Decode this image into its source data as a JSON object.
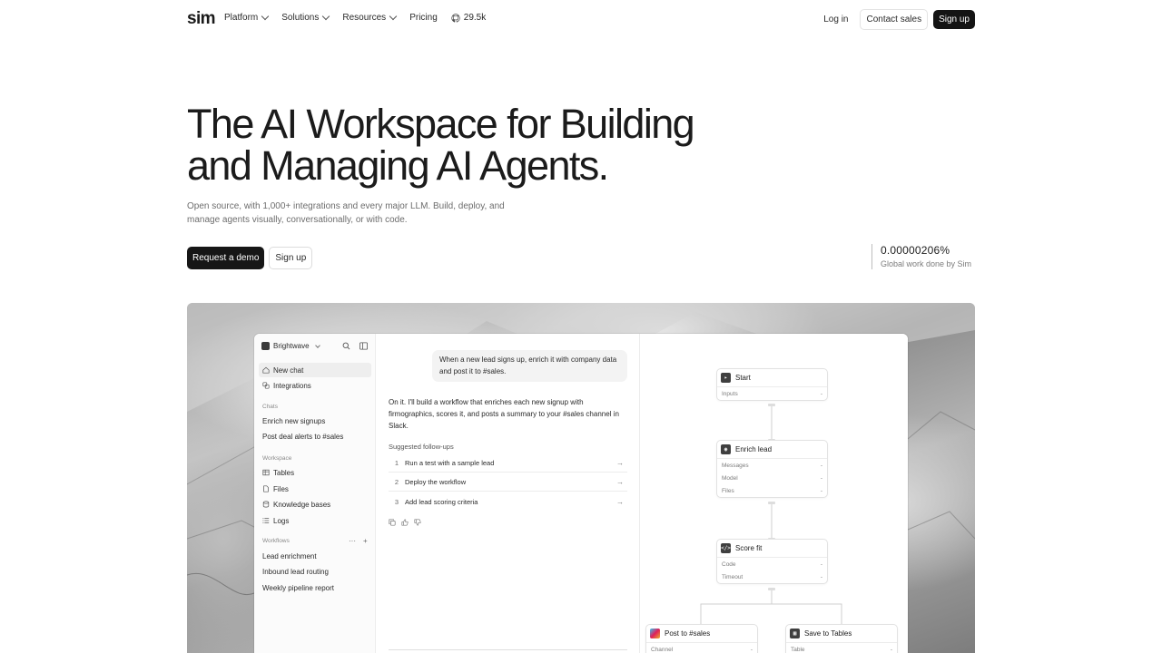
{
  "nav": {
    "logo": "sim",
    "links": [
      {
        "label": "Platform",
        "dropdown": true
      },
      {
        "label": "Solutions",
        "dropdown": true
      },
      {
        "label": "Resources",
        "dropdown": true
      },
      {
        "label": "Pricing",
        "dropdown": false
      }
    ],
    "github_stars": "29.5k",
    "login": "Log in",
    "contact": "Contact sales",
    "signup": "Sign up"
  },
  "hero": {
    "title_line1": "The AI Workspace for Building",
    "title_line2": "and Managing AI Agents.",
    "subtitle_line1": "Open source, with 1,000+ integrations and every major LLM. Build, deploy, and",
    "subtitle_line2": "manage agents visually, conversationally, or with code.",
    "cta_primary": "Request a demo",
    "cta_secondary": "Sign up",
    "stat_value": "0.00000206%",
    "stat_label": "Global work done by Sim"
  },
  "app": {
    "workspace_name": "Brightwave",
    "sidebar": {
      "new_chat": "New chat",
      "integrations": "Integrations",
      "chats_heading": "Chats",
      "chats": [
        "Enrich new signups",
        "Post deal alerts to #sales"
      ],
      "workspace_heading": "Workspace",
      "workspace_items": [
        "Tables",
        "Files",
        "Knowledge bases",
        "Logs"
      ],
      "workflows_heading": "Workflows",
      "workflows": [
        "Lead enrichment",
        "Inbound lead routing",
        "Weekly pipeline report"
      ]
    },
    "chat": {
      "user_message": "When a new lead signs up, enrich it with company data and post it to #sales.",
      "assistant_reply": "On it. I'll build a workflow that enriches each new signup with firmographics, scores it, and posts a summary to your #sales channel in Slack.",
      "followups_heading": "Suggested follow-ups",
      "followups": [
        {
          "num": "1",
          "label": "Run a test with a sample lead"
        },
        {
          "num": "2",
          "label": "Deploy the workflow"
        },
        {
          "num": "3",
          "label": "Add lead scoring criteria"
        }
      ]
    },
    "canvas": {
      "nodes": {
        "start": {
          "title": "Start",
          "fields": [
            {
              "name": "Inputs",
              "value": "-"
            }
          ]
        },
        "enrich": {
          "title": "Enrich lead",
          "fields": [
            {
              "name": "Messages",
              "value": "-"
            },
            {
              "name": "Model",
              "value": "-"
            },
            {
              "name": "Files",
              "value": "-"
            }
          ]
        },
        "score": {
          "title": "Score fit",
          "fields": [
            {
              "name": "Code",
              "value": "-"
            },
            {
              "name": "Timeout",
              "value": "-"
            }
          ]
        },
        "slack": {
          "title": "Post to #sales",
          "fields": [
            {
              "name": "Channel",
              "value": "-"
            }
          ]
        },
        "tables": {
          "title": "Save to Tables",
          "fields": [
            {
              "name": "Table",
              "value": "-"
            }
          ]
        }
      }
    }
  },
  "colors": {
    "primary_button": "#161616",
    "text": "#1b1b1b",
    "muted_text": "#6d6d6d",
    "sidebar_bg": "#fbfbfb"
  }
}
